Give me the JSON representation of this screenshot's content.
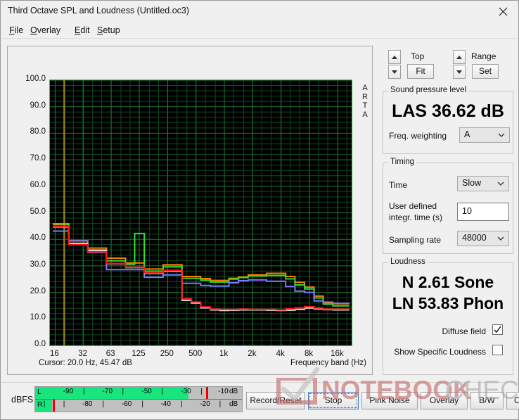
{
  "window": {
    "title": "Third Octave SPL and Loudness (Untitled.oc3)",
    "close_icon": "close-icon"
  },
  "menu": {
    "items": [
      {
        "label": "File",
        "mnemonic": "F",
        "rest": "ile"
      },
      {
        "label": "Overlay",
        "mnemonic": "O",
        "rest": "verlay"
      },
      {
        "label": "Edit",
        "mnemonic": "E",
        "rest": "dit"
      },
      {
        "label": "Setup",
        "mnemonic": "S",
        "rest": "etup"
      }
    ]
  },
  "graph": {
    "title": "Third octave SPL",
    "y_unit": "dB",
    "watermark_right": "ARTA",
    "cursor_text": "Cursor:   20.0 Hz, 45.47 dB",
    "xaxis_title": "Frequency band (Hz)",
    "cursor_freq_hz": 20.0,
    "cursor_level_db": 45.47
  },
  "chart_data": {
    "type": "line",
    "title": "Third octave SPL",
    "xlabel": "Frequency band (Hz)",
    "ylabel": "dB",
    "ylim": [
      0.0,
      100.0
    ],
    "ytick_labels": [
      "100.0",
      "90.0",
      "80.0",
      "70.0",
      "60.0",
      "50.0",
      "40.0",
      "30.0",
      "20.0",
      "10.0",
      "0.0"
    ],
    "ytick_values": [
      100,
      90,
      80,
      70,
      60,
      50,
      40,
      30,
      20,
      10,
      0
    ],
    "xtick_labels": [
      "16",
      "32",
      "63",
      "125",
      "250",
      "500",
      "1k",
      "2k",
      "4k",
      "8k",
      "16k"
    ],
    "xtick_values": [
      16,
      32,
      63,
      125,
      250,
      500,
      1000,
      2000,
      4000,
      8000,
      16000
    ],
    "grid": true,
    "grid_color": "#1d7a33",
    "plot_bg": "#000000",
    "cursor_line_color": "#9a8a14",
    "categories": [
      16,
      20,
      25,
      31.5,
      40,
      50,
      63,
      80,
      100,
      125,
      160,
      200,
      250,
      315,
      400,
      500,
      630,
      800,
      1000,
      1250,
      1600,
      2000,
      2500,
      3150,
      4000,
      5000,
      6300,
      8000,
      10000,
      12500,
      16000,
      20000
    ],
    "series": [
      {
        "name": "orange",
        "color": "#ff8000",
        "values": [
          45.6,
          45.6,
          39.5,
          39.5,
          36.7,
          36.7,
          32.9,
          32.9,
          31.1,
          31.1,
          28.8,
          28.8,
          30.4,
          30.4,
          26.0,
          26.0,
          25.2,
          24.5,
          24.5,
          25.3,
          25.8,
          26.6,
          26.6,
          27.2,
          27.2,
          26.0,
          23.8,
          22.0,
          18.6,
          16.3,
          15.7,
          15.7
        ]
      },
      {
        "name": "green",
        "color": "#2ee02e",
        "values": [
          45.9,
          45.9,
          38.1,
          38.1,
          36.0,
          36.0,
          31.9,
          31.9,
          30.6,
          42.2,
          28.0,
          28.0,
          29.6,
          29.6,
          25.3,
          25.3,
          24.6,
          23.9,
          23.9,
          25.0,
          25.6,
          26.2,
          26.2,
          26.4,
          26.4,
          25.1,
          22.8,
          21.3,
          17.9,
          15.6,
          14.9,
          14.9
        ]
      },
      {
        "name": "blue",
        "color": "#7a7aff",
        "values": [
          43.1,
          43.1,
          39.4,
          39.4,
          35.1,
          35.1,
          28.6,
          28.6,
          28.6,
          28.6,
          25.7,
          25.7,
          26.6,
          26.6,
          23.4,
          23.4,
          22.6,
          22.4,
          22.4,
          23.6,
          24.4,
          24.7,
          24.7,
          24.2,
          24.2,
          22.2,
          20.5,
          20.0,
          16.8,
          15.9,
          15.9,
          15.9
        ]
      },
      {
        "name": "white",
        "color": "#e0e0e0",
        "values": [
          44.7,
          44.7,
          38.5,
          38.5,
          35.8,
          35.8,
          30.8,
          30.8,
          29.4,
          29.4,
          27.2,
          27.2,
          28.0,
          28.0,
          17.0,
          16.0,
          14.2,
          13.4,
          13.2,
          13.3,
          13.4,
          13.4,
          13.4,
          13.3,
          13.2,
          13.3,
          13.6,
          14.1,
          13.8,
          13.5,
          13.4,
          13.4
        ]
      },
      {
        "name": "red",
        "color": "#ff1010",
        "values": [
          44.9,
          44.9,
          38.0,
          38.0,
          35.3,
          35.3,
          30.9,
          30.9,
          29.5,
          29.5,
          27.4,
          27.4,
          28.3,
          28.3,
          17.6,
          16.4,
          14.5,
          13.7,
          13.6,
          13.6,
          13.7,
          13.6,
          13.6,
          13.6,
          13.4,
          13.9,
          14.2,
          14.6,
          14.1,
          13.7,
          13.7,
          13.7
        ]
      }
    ]
  },
  "top_control": {
    "label": "Top",
    "button": "Fit",
    "up_icon": "chevron-up-icon",
    "down_icon": "chevron-down-icon"
  },
  "range_control": {
    "label": "Range",
    "button": "Set",
    "up_icon": "chevron-up-icon",
    "down_icon": "chevron-down-icon"
  },
  "spl": {
    "legend": "Sound pressure level",
    "value": "LAS 36.62 dB",
    "weighting_label": "Freq. weighting",
    "weighting_value": "A",
    "chevron_icon": "chevron-down-icon"
  },
  "timing": {
    "legend": "Timing",
    "time_label": "Time",
    "time_value": "Slow",
    "integration_label_line1": "User defined",
    "integration_label_line2": "integr. time (s)",
    "integration_value": "10",
    "sampling_label": "Sampling rate",
    "sampling_value": "48000",
    "chevron_icon": "chevron-down-icon"
  },
  "loudness": {
    "legend": "Loudness",
    "sone": "N 2.61 Sone",
    "phon": "LN 53.83 Phon",
    "diffuse_field_label": "Diffuse field",
    "diffuse_field_checked": true,
    "specific_loudness_label": "Show Specific Loudness",
    "specific_loudness_checked": false,
    "check_icon": "check-icon"
  },
  "meters": {
    "label": "dBFS",
    "left_channel": "L",
    "right_channel": "R",
    "unit": "dB",
    "left_ticks": [
      "-90",
      "-70",
      "-50",
      "-30",
      "-10"
    ],
    "right_ticks": [
      "-80",
      "-60",
      "-40",
      "-20"
    ],
    "left_fill_percent": 74,
    "right_fill_percent": 8,
    "bar_color": "#19e57f",
    "peak_color": "#ee0000"
  },
  "buttons": [
    {
      "label": "Record/Reset",
      "focused": false
    },
    {
      "label": "Stop",
      "focused": true
    },
    {
      "label": "Pink Noise",
      "focused": false
    },
    {
      "label": "Overlay",
      "focused": false
    },
    {
      "label": "B/W",
      "focused": false
    },
    {
      "label": "Copy",
      "focused": false
    }
  ],
  "watermark": {
    "text_bold": "NOTEBOOK",
    "text_light": "CHECK",
    "color_bold": "#c46b6b",
    "color_light": "#9a9a9a"
  }
}
